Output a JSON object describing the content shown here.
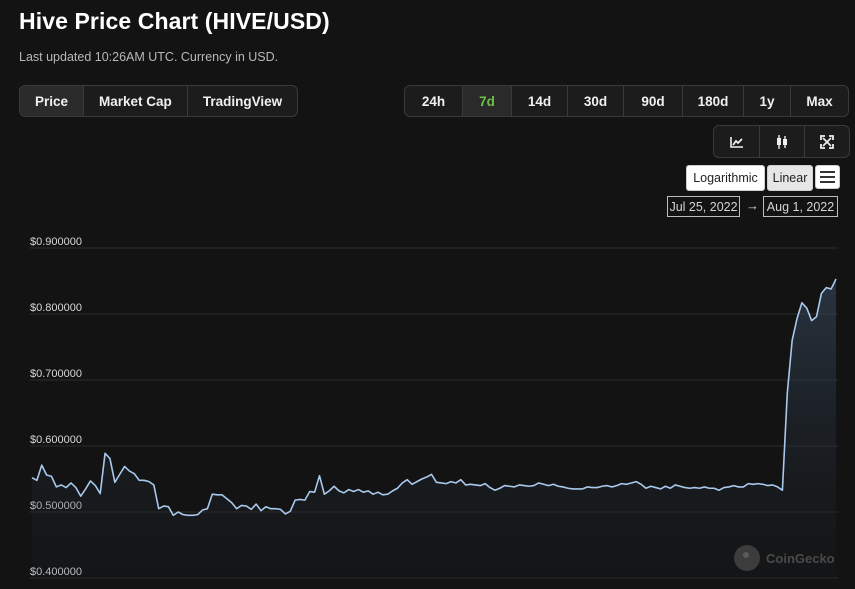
{
  "header": {
    "title": "Hive Price Chart (HIVE/USD)",
    "subtitle": "Last updated 10:26AM UTC. Currency in USD."
  },
  "view_tabs": [
    {
      "label": "Price",
      "active": true
    },
    {
      "label": "Market Cap",
      "active": false
    },
    {
      "label": "TradingView",
      "active": false
    }
  ],
  "range_tabs": [
    {
      "label": "24h",
      "active": false
    },
    {
      "label": "7d",
      "active": true
    },
    {
      "label": "14d",
      "active": false
    },
    {
      "label": "30d",
      "active": false
    },
    {
      "label": "90d",
      "active": false
    },
    {
      "label": "180d",
      "active": false
    },
    {
      "label": "1y",
      "active": false
    },
    {
      "label": "Max",
      "active": false
    }
  ],
  "chart_tools": [
    "line-chart-icon",
    "candlestick-icon",
    "fullscreen-icon"
  ],
  "scale": {
    "log_label": "Logarithmic",
    "linear_label": "Linear",
    "selected": "Linear"
  },
  "date_range": {
    "from": "Jul 25, 2022",
    "to": "Aug 1, 2022",
    "arrow": "→"
  },
  "watermark": {
    "text": "CoinGecko"
  },
  "colors": {
    "line": "#a8c8ec",
    "background": "#131313",
    "active_range": "#6cc24a",
    "grid": "#2c2c2c"
  },
  "chart_data": {
    "type": "area",
    "ylim": [
      0.4,
      0.9
    ],
    "yticks": [
      {
        "value": 0.9,
        "label": "$0.900000"
      },
      {
        "value": 0.8,
        "label": "$0.800000"
      },
      {
        "value": 0.7,
        "label": "$0.700000"
      },
      {
        "value": 0.6,
        "label": "$0.600000"
      },
      {
        "value": 0.5,
        "label": "$0.500000"
      },
      {
        "value": 0.4,
        "label": "$0.400000"
      }
    ],
    "grid": true,
    "x_start": "Jul 25, 2022",
    "x_end": "Aug 1, 2022",
    "values": [
      0.552,
      0.548,
      0.571,
      0.556,
      0.554,
      0.538,
      0.541,
      0.537,
      0.544,
      0.537,
      0.524,
      0.535,
      0.547,
      0.54,
      0.528,
      0.589,
      0.581,
      0.545,
      0.557,
      0.569,
      0.562,
      0.558,
      0.548,
      0.548,
      0.546,
      0.541,
      0.505,
      0.509,
      0.508,
      0.495,
      0.5,
      0.496,
      0.495,
      0.495,
      0.496,
      0.503,
      0.505,
      0.527,
      0.526,
      0.526,
      0.52,
      0.514,
      0.505,
      0.51,
      0.509,
      0.504,
      0.512,
      0.502,
      0.508,
      0.505,
      0.505,
      0.504,
      0.497,
      0.501,
      0.518,
      0.519,
      0.518,
      0.531,
      0.53,
      0.555,
      0.527,
      0.532,
      0.539,
      0.532,
      0.529,
      0.534,
      0.531,
      0.534,
      0.53,
      0.532,
      0.527,
      0.53,
      0.526,
      0.527,
      0.532,
      0.536,
      0.544,
      0.549,
      0.542,
      0.546,
      0.55,
      0.553,
      0.557,
      0.545,
      0.544,
      0.543,
      0.546,
      0.544,
      0.549,
      0.541,
      0.542,
      0.541,
      0.54,
      0.543,
      0.537,
      0.533,
      0.536,
      0.54,
      0.539,
      0.538,
      0.541,
      0.54,
      0.539,
      0.54,
      0.544,
      0.542,
      0.54,
      0.542,
      0.539,
      0.538,
      0.536,
      0.535,
      0.535,
      0.535,
      0.538,
      0.537,
      0.537,
      0.539,
      0.54,
      0.538,
      0.54,
      0.543,
      0.542,
      0.544,
      0.546,
      0.542,
      0.536,
      0.539,
      0.537,
      0.535,
      0.539,
      0.536,
      0.541,
      0.539,
      0.537,
      0.536,
      0.537,
      0.536,
      0.538,
      0.536,
      0.536,
      0.533,
      0.537,
      0.538,
      0.54,
      0.538,
      0.538,
      0.543,
      0.542,
      0.543,
      0.542,
      0.54,
      0.541,
      0.538,
      0.533,
      0.68,
      0.76,
      0.793,
      0.817,
      0.809,
      0.79,
      0.796,
      0.831,
      0.84,
      0.838,
      0.853
    ]
  }
}
